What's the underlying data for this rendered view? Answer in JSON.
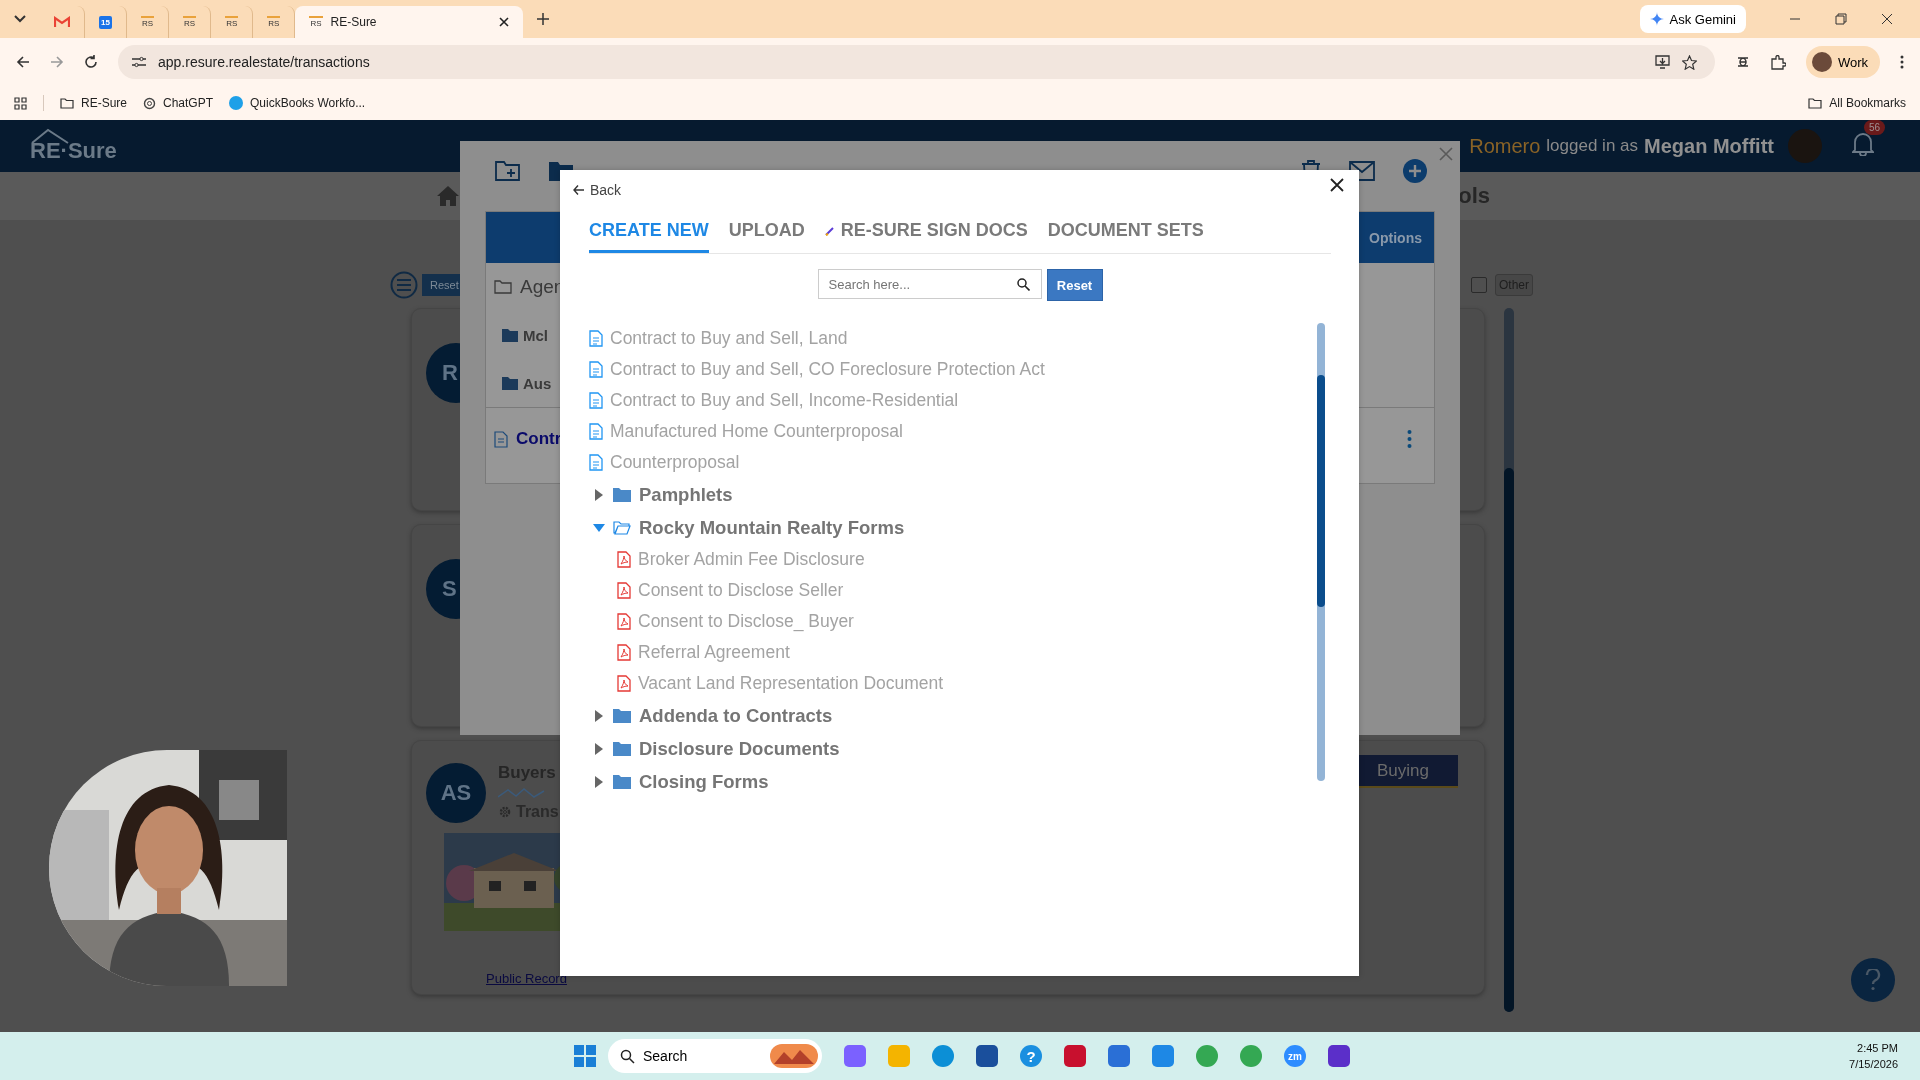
{
  "browser": {
    "tabs": [
      {
        "kind": "gmail",
        "selected": false
      },
      {
        "kind": "calendar",
        "label": "15",
        "selected": false
      },
      {
        "kind": "rs",
        "label": "RS",
        "selected": false
      },
      {
        "kind": "rs",
        "label": "RS",
        "selected": false
      },
      {
        "kind": "rs",
        "label": "RS",
        "selected": false
      },
      {
        "kind": "rs",
        "label": "RS",
        "selected": false
      },
      {
        "kind": "rs",
        "label": "RS",
        "title": "RE-Sure",
        "selected": true
      }
    ],
    "ask_gemini": "Ask Gemini",
    "url": "app.resure.realestate/transactions",
    "profile": "Work",
    "bookmarks": [
      {
        "kind": "folder",
        "label": "RE-Sure"
      },
      {
        "kind": "chatgpt",
        "label": "ChatGPT"
      },
      {
        "kind": "quickbooks",
        "label": "QuickBooks Workfo..."
      }
    ],
    "all_bookmarks": "All Bookmarks"
  },
  "header": {
    "logo": "RE·Sure",
    "user_prefix": "Romero",
    "logged_in_label": "logged in as",
    "user_name": "Megan Moffitt",
    "notifications": "56"
  },
  "nav": {
    "cut_label": "ols"
  },
  "filters": {
    "reset": "Reset",
    "other": {
      "label": "Other",
      "checked": false
    }
  },
  "cards": [
    {
      "avatar": "R"
    },
    {
      "avatar": "S"
    },
    {
      "avatar": "AS",
      "title": "Buyers",
      "meta": "Trans",
      "link": "Public Record",
      "badge": "Buying"
    }
  ],
  "back_modal": {
    "options": "Options",
    "folder_header": "Agen",
    "folders": [
      "Mcl",
      "Aus"
    ],
    "document": "Contr"
  },
  "modal": {
    "back": "Back",
    "tabs": [
      {
        "label": "CREATE NEW",
        "selected": true
      },
      {
        "label": "UPLOAD",
        "selected": false
      },
      {
        "label": "RE-SURE SIGN DOCS",
        "kind": "sign",
        "selected": false
      },
      {
        "label": "DOCUMENT SETS",
        "selected": false
      }
    ],
    "search": {
      "placeholder": "Search here..."
    },
    "reset": "Reset",
    "tree": [
      {
        "kind": "doc",
        "label": "Contract to Buy and Sell, Land"
      },
      {
        "kind": "doc",
        "label": "Contract to Buy and Sell, CO Foreclosure Protection Act"
      },
      {
        "kind": "doc",
        "label": "Contract to Buy and Sell, Income-Residential"
      },
      {
        "kind": "doc",
        "label": "Manufactured Home Counterproposal"
      },
      {
        "kind": "doc",
        "label": "Counterproposal"
      },
      {
        "kind": "folder",
        "label": "Pamphlets",
        "expanded": false
      },
      {
        "kind": "folder",
        "label": "Rocky Mountain Realty Forms",
        "expanded": true,
        "children": [
          {
            "kind": "pdf",
            "label": "Broker Admin Fee Disclosure"
          },
          {
            "kind": "pdf",
            "label": "Consent to Disclose Seller"
          },
          {
            "kind": "pdf",
            "label": "Consent to Disclose_ Buyer"
          },
          {
            "kind": "pdf",
            "label": "Referral Agreement"
          },
          {
            "kind": "pdf",
            "label": "Vacant Land Representation Document"
          }
        ]
      },
      {
        "kind": "folder",
        "label": "Addenda to Contracts",
        "expanded": false
      },
      {
        "kind": "folder",
        "label": "Disclosure Documents",
        "expanded": false
      },
      {
        "kind": "folder",
        "label": "Closing Forms",
        "expanded": false
      }
    ]
  },
  "taskbar": {
    "search": "Search",
    "apps": [
      {
        "kind": "copilot"
      },
      {
        "kind": "files"
      },
      {
        "kind": "edge"
      },
      {
        "kind": "store"
      },
      {
        "kind": "help",
        "label": "?"
      },
      {
        "kind": "shield"
      },
      {
        "kind": "beta"
      },
      {
        "kind": "pre"
      },
      {
        "kind": "chrome"
      },
      {
        "kind": "chrome"
      },
      {
        "kind": "zoom",
        "label": "zm"
      },
      {
        "kind": "app"
      }
    ],
    "time": "2:45 PM",
    "date": "7/15/2026"
  }
}
